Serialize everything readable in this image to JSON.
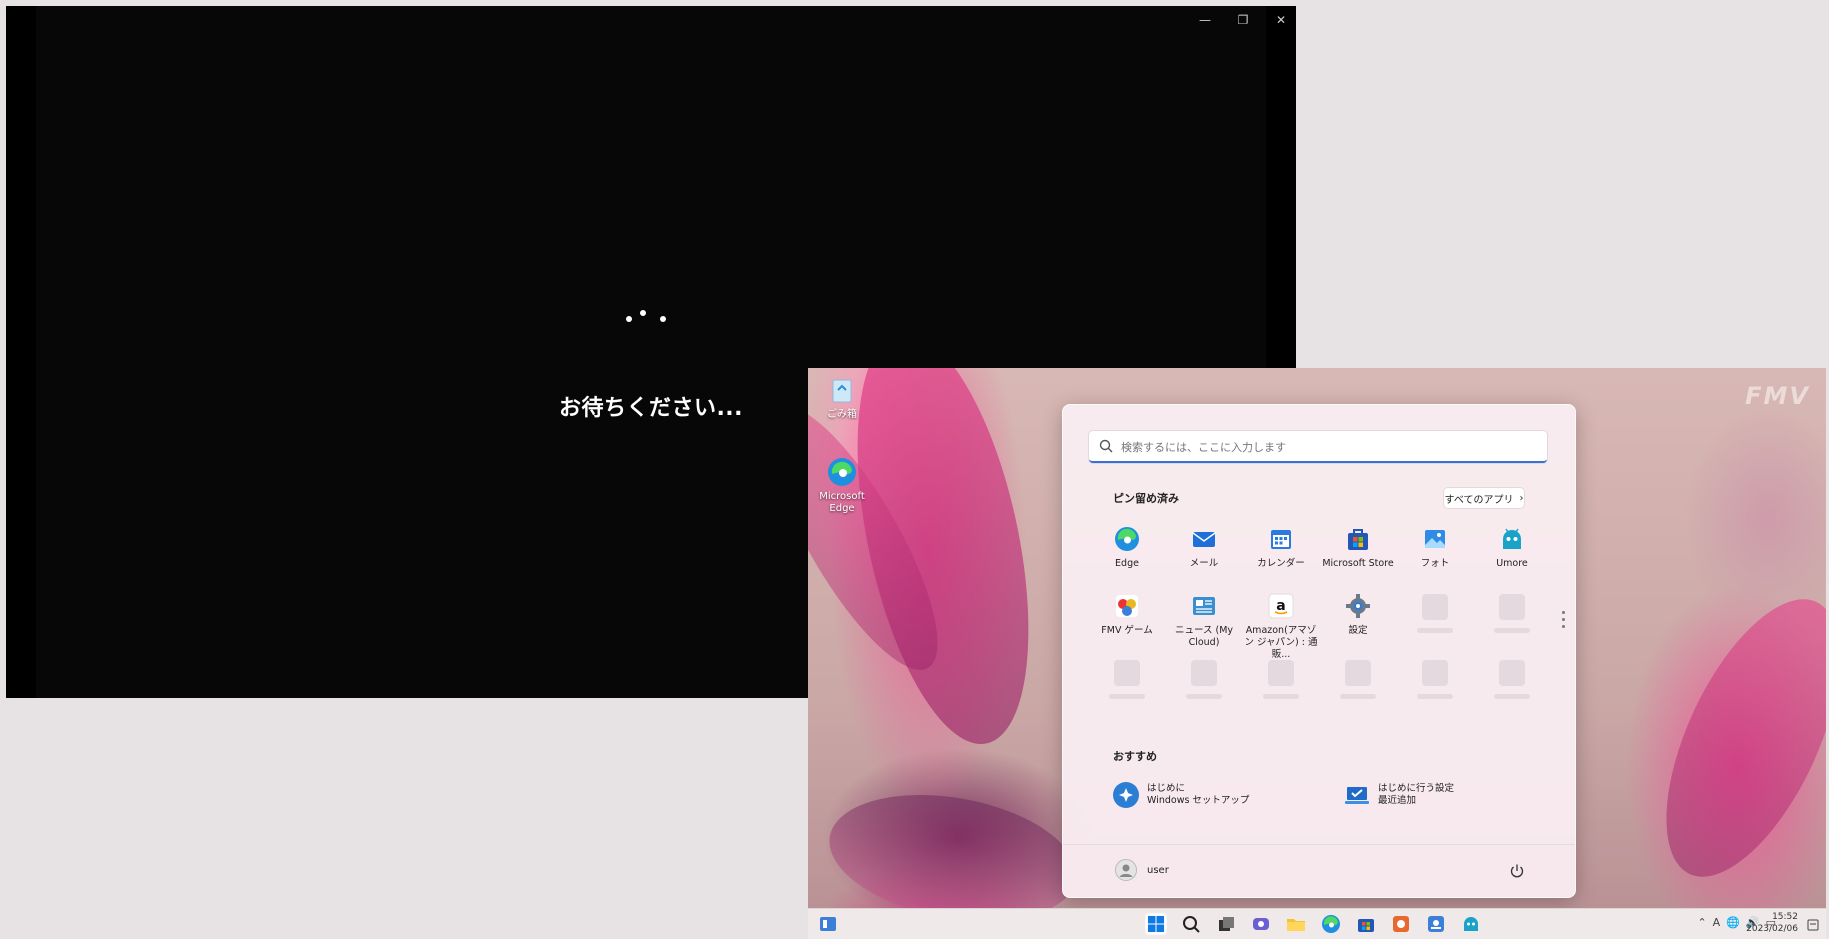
{
  "setup_window": {
    "wait_text": "お待ちください...",
    "controls": {
      "minimize": "—",
      "maximize": "❐",
      "close": "✕"
    }
  },
  "desktop": {
    "brand_logo": "FMV",
    "icons": [
      {
        "label": "ごみ箱",
        "icon": "recycle-bin-icon"
      },
      {
        "label": "Microsoft Edge",
        "icon": "edge-icon"
      }
    ]
  },
  "start_menu": {
    "search_placeholder": "検索するには、ここに入力します",
    "pinned_title": "ピン留め済み",
    "all_apps_label": "すべてのアプリ",
    "pinned_apps": [
      {
        "label": "Edge",
        "icon": "edge-icon",
        "color": "#1f8fe0"
      },
      {
        "label": "メール",
        "icon": "mail-icon",
        "color": "#1e6fd9"
      },
      {
        "label": "カレンダー",
        "icon": "calendar-icon",
        "color": "#2b7ae0"
      },
      {
        "label": "Microsoft Store",
        "icon": "store-icon",
        "color": "#2456b8"
      },
      {
        "label": "フォト",
        "icon": "photos-icon",
        "color": "#2f8be3"
      },
      {
        "label": "Umore",
        "icon": "umore-icon",
        "color": "#1aa3c8"
      },
      {
        "label": "FMV ゲーム",
        "icon": "fmv-game-icon",
        "color": "#e8b820"
      },
      {
        "label": "ニュース (My Cloud)",
        "icon": "news-icon",
        "color": "#3a8fd0"
      },
      {
        "label": "Amazon(アマゾン ジャパン) : 通販...",
        "icon": "amazon-icon",
        "color": "#ffffff"
      },
      {
        "label": "設定",
        "icon": "settings-gear-icon",
        "color": "#6a7a8c"
      }
    ],
    "recommended_title": "おすすめ",
    "recommended": [
      {
        "title": "はじめに",
        "subtitle": "Windows セットアップ",
        "icon": "get-started-icon",
        "color": "#2a7fd4"
      },
      {
        "title": "はじめに行う設定",
        "subtitle": "最近追加",
        "icon": "initial-settings-icon",
        "color": "#1f6cc8"
      }
    ],
    "user_name": "user"
  },
  "taskbar": {
    "time": "15:52",
    "date": "2023/02/06",
    "ime_indicator": "A",
    "icons": [
      "start-icon",
      "search-icon",
      "task-view-icon",
      "chat-icon",
      "file-explorer-icon",
      "edge-icon",
      "store-icon",
      "app-icon",
      "fmv-app-icon",
      "umore-icon"
    ]
  }
}
